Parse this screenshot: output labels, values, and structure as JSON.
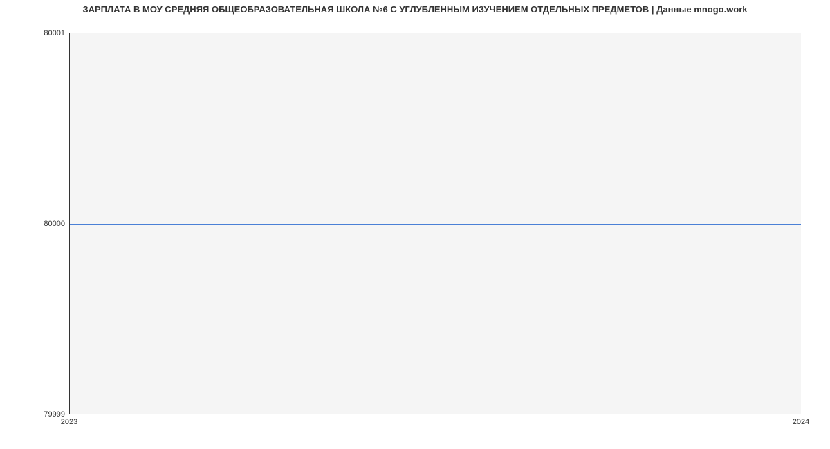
{
  "chart_data": {
    "type": "line",
    "title": "ЗАРПЛАТА В МОУ СРЕДНЯЯ ОБЩЕОБРАЗОВАТЕЛЬНАЯ ШКОЛА №6 С УГЛУБЛЕННЫМ ИЗУЧЕНИЕМ ОТДЕЛЬНЫХ ПРЕДМЕТОВ | Данные mnogo.work",
    "x": [
      2023,
      2024
    ],
    "values": [
      80000,
      80000
    ],
    "xlabel": "",
    "ylabel": "",
    "xlim": [
      2023,
      2024
    ],
    "ylim": [
      79999,
      80001
    ],
    "x_ticks": [
      "2023",
      "2024"
    ],
    "y_ticks": [
      "79999",
      "80000",
      "80001"
    ]
  }
}
